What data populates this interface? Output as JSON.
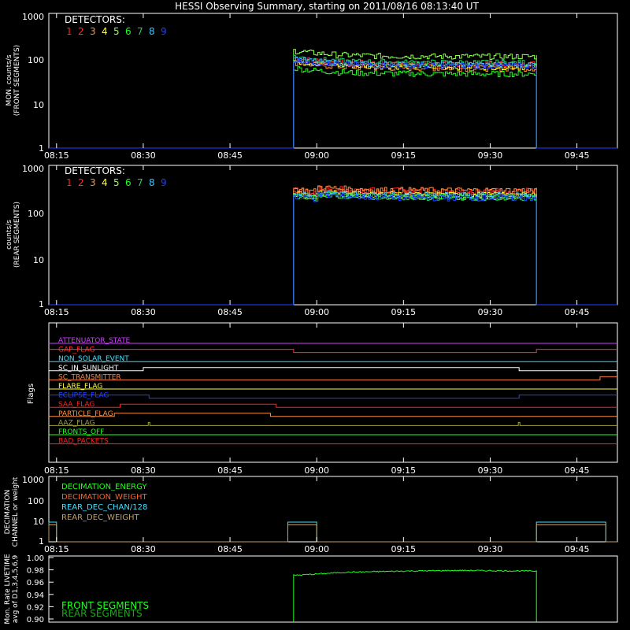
{
  "title": "HESSI Observing Summary, starting on 2011/08/16 08:13:40 UT",
  "colors": {
    "background": "#000000",
    "axis": "#ffffff",
    "det": [
      "#ff2020",
      "#ff3030",
      "#ff9040",
      "#ffff20",
      "#90ff50",
      "#20ff20",
      "#20d060",
      "#40c0ff",
      "#2040ff"
    ]
  },
  "x_ticks": [
    "08:15",
    "08:30",
    "08:45",
    "09:00",
    "09:15",
    "09:30",
    "09:45"
  ],
  "panels": {
    "front": {
      "ylabel1": "MON. counts/s",
      "ylabel2": "(FRONT SEGMENTS)",
      "yticks": [
        "1000",
        "100",
        "10",
        "1"
      ],
      "legend_title": "DETECTORS:",
      "det_digits": [
        "1",
        "2",
        "3",
        "4",
        "5",
        "6",
        "7",
        "8",
        "9"
      ]
    },
    "rear": {
      "ylabel1": "counts/s",
      "ylabel2": "(REAR SEGMENTS)",
      "yticks": [
        "1000",
        "100",
        "10",
        "1"
      ],
      "legend_title": "DETECTORS:",
      "det_digits": [
        "1",
        "2",
        "3",
        "4",
        "5",
        "6",
        "7",
        "8",
        "9"
      ]
    },
    "flags": {
      "ylabel": "Flags"
    },
    "decimation": {
      "ylabel1": "DECIMATION",
      "ylabel2": "CHANNEL or weight",
      "yticks": [
        "1000",
        "100",
        "10",
        "1"
      ],
      "legend": [
        "DECIMATION_ENERGY",
        "DECIMATION_WEIGHT",
        "REAR_DEC_CHAN/128",
        "REAR_DEC_WEIGHT"
      ]
    },
    "livetime": {
      "ylabel1": "Mon. Rate LIVETIME",
      "ylabel2": "avg of D1,3,4,5,6,9",
      "yticks": [
        "1.00",
        "0.98",
        "0.96",
        "0.94",
        "0.92",
        "0.90"
      ],
      "legend": [
        "FRONT SEGMENTS",
        "REAR SEGMENTS"
      ]
    }
  },
  "chart_data": [
    {
      "type": "line",
      "title": "HESSI Observing Summary, starting on 2011/08/16 08:13:40 UT",
      "ylabel": "MON. counts/s (FRONT SEGMENTS)",
      "yscale": "log",
      "ylim": [
        1,
        1000
      ],
      "xlim": [
        "08:13:40",
        "09:52:00"
      ],
      "observation_window": [
        "08:56",
        "09:38"
      ],
      "series": [
        {
          "name": "1",
          "color": "#ff2020",
          "level": 75
        },
        {
          "name": "2",
          "color": "#ff3030",
          "level": 70
        },
        {
          "name": "3",
          "color": "#ff9040",
          "level": 60
        },
        {
          "name": "4",
          "color": "#ffff20",
          "level": 65
        },
        {
          "name": "5",
          "color": "#90ff50",
          "level": 110
        },
        {
          "name": "6",
          "color": "#20ff20",
          "level": 45
        },
        {
          "name": "7",
          "color": "#20d060",
          "level": 80
        },
        {
          "name": "8",
          "color": "#40c0ff",
          "level": 72
        },
        {
          "name": "9",
          "color": "#2040ff",
          "level": 68
        }
      ]
    },
    {
      "type": "line",
      "ylabel": "counts/s (REAR SEGMENTS)",
      "yscale": "log",
      "ylim": [
        1,
        1000
      ],
      "observation_window": [
        "08:56",
        "09:38"
      ],
      "series": [
        {
          "name": "1",
          "color": "#ff2020",
          "level": 280
        },
        {
          "name": "2",
          "color": "#ff3030",
          "level": 260
        },
        {
          "name": "3",
          "color": "#ff9040",
          "level": 290
        },
        {
          "name": "4",
          "color": "#ffff20",
          "level": 230
        },
        {
          "name": "5",
          "color": "#90ff50",
          "level": 215
        },
        {
          "name": "6",
          "color": "#20ff20",
          "level": 210
        },
        {
          "name": "7",
          "color": "#20d060",
          "level": 205
        },
        {
          "name": "8",
          "color": "#40c0ff",
          "level": 225
        },
        {
          "name": "9",
          "color": "#2040ff",
          "level": 200
        }
      ]
    },
    {
      "type": "line",
      "ylabel": "Flags",
      "flags": [
        {
          "name": "ATTENUATOR_STATE",
          "color": "#d040ff",
          "changes": []
        },
        {
          "name": "GAP_FLAG",
          "color": "#ff3030",
          "changes": [
            {
              "t": "08:56",
              "to": "low"
            },
            {
              "t": "09:38",
              "to": "high"
            }
          ]
        },
        {
          "name": "NON_SOLAR_EVENT",
          "color": "#40e0ff",
          "changes": []
        },
        {
          "name": "SC_IN_SUNLIGHT",
          "color": "#ffffff",
          "changes": [
            {
              "t": "08:30",
              "to": "high"
            },
            {
              "t": "09:35",
              "to": "low"
            }
          ]
        },
        {
          "name": "SC_TRANSMITTER",
          "color": "#ff8040",
          "changes": [
            {
              "t": "09:49",
              "to": "high"
            }
          ]
        },
        {
          "name": "FLARE_FLAG",
          "color": "#ffff40",
          "changes": []
        },
        {
          "name": "ECLIPSE_FLAG",
          "color": "#2040ff",
          "changes": [
            {
              "t": "08:31",
              "to": "low"
            },
            {
              "t": "09:35",
              "to": "high"
            }
          ]
        },
        {
          "name": "SAA_FLAG",
          "color": "#ff2020",
          "changes": [
            {
              "t": "08:26",
              "to": "high"
            },
            {
              "t": "08:53",
              "to": "low"
            }
          ]
        },
        {
          "name": "PARTICLE_FLAG",
          "color": "#ff9040",
          "changes": [
            {
              "t": "08:25",
              "to": "high"
            },
            {
              "t": "08:52",
              "to": "low"
            }
          ]
        },
        {
          "name": "AAZ_FLAG",
          "color": "#a0a040",
          "spikes": [
            "08:31",
            "09:35"
          ]
        },
        {
          "name": "FRONTS_OFF",
          "color": "#20ff20",
          "changes": []
        },
        {
          "name": "BAD_PACKETS",
          "color": "#ff2020",
          "changes": []
        }
      ]
    },
    {
      "type": "line",
      "ylabel": "DECIMATION CHANNEL or weight",
      "yscale": "log",
      "ylim": [
        1,
        1000
      ],
      "series": [
        {
          "name": "DECIMATION_ENERGY",
          "color": "#20ff20"
        },
        {
          "name": "DECIMATION_WEIGHT",
          "color": "#ff6020"
        },
        {
          "name": "REAR_DEC_CHAN/128",
          "color": "#40e0ff",
          "high_value": 8,
          "high_intervals": [
            [
              "08:13:40",
              "08:15"
            ],
            [
              "08:55",
              "09:00"
            ],
            [
              "09:38",
              "09:50"
            ]
          ]
        },
        {
          "name": "REAR_DEC_WEIGHT",
          "color": "#c0a060",
          "high_value": 6,
          "high_intervals": [
            [
              "08:13:40",
              "08:15"
            ],
            [
              "08:55",
              "09:00"
            ],
            [
              "09:38",
              "09:50"
            ]
          ]
        }
      ]
    },
    {
      "type": "line",
      "ylabel": "Mon. Rate LIVETIME avg of D1,3,4,5,6,9",
      "ylim": [
        0.9,
        1.0
      ],
      "observation_window": [
        "08:56",
        "09:38"
      ],
      "series": [
        {
          "name": "FRONT SEGMENTS",
          "color": "#20ff20",
          "x": [
            "08:56",
            "09:05",
            "09:15",
            "09:25",
            "09:38"
          ],
          "y": [
            0.971,
            0.976,
            0.978,
            0.979,
            0.978
          ]
        },
        {
          "name": "REAR SEGMENTS",
          "color": "#20a020"
        }
      ]
    }
  ]
}
